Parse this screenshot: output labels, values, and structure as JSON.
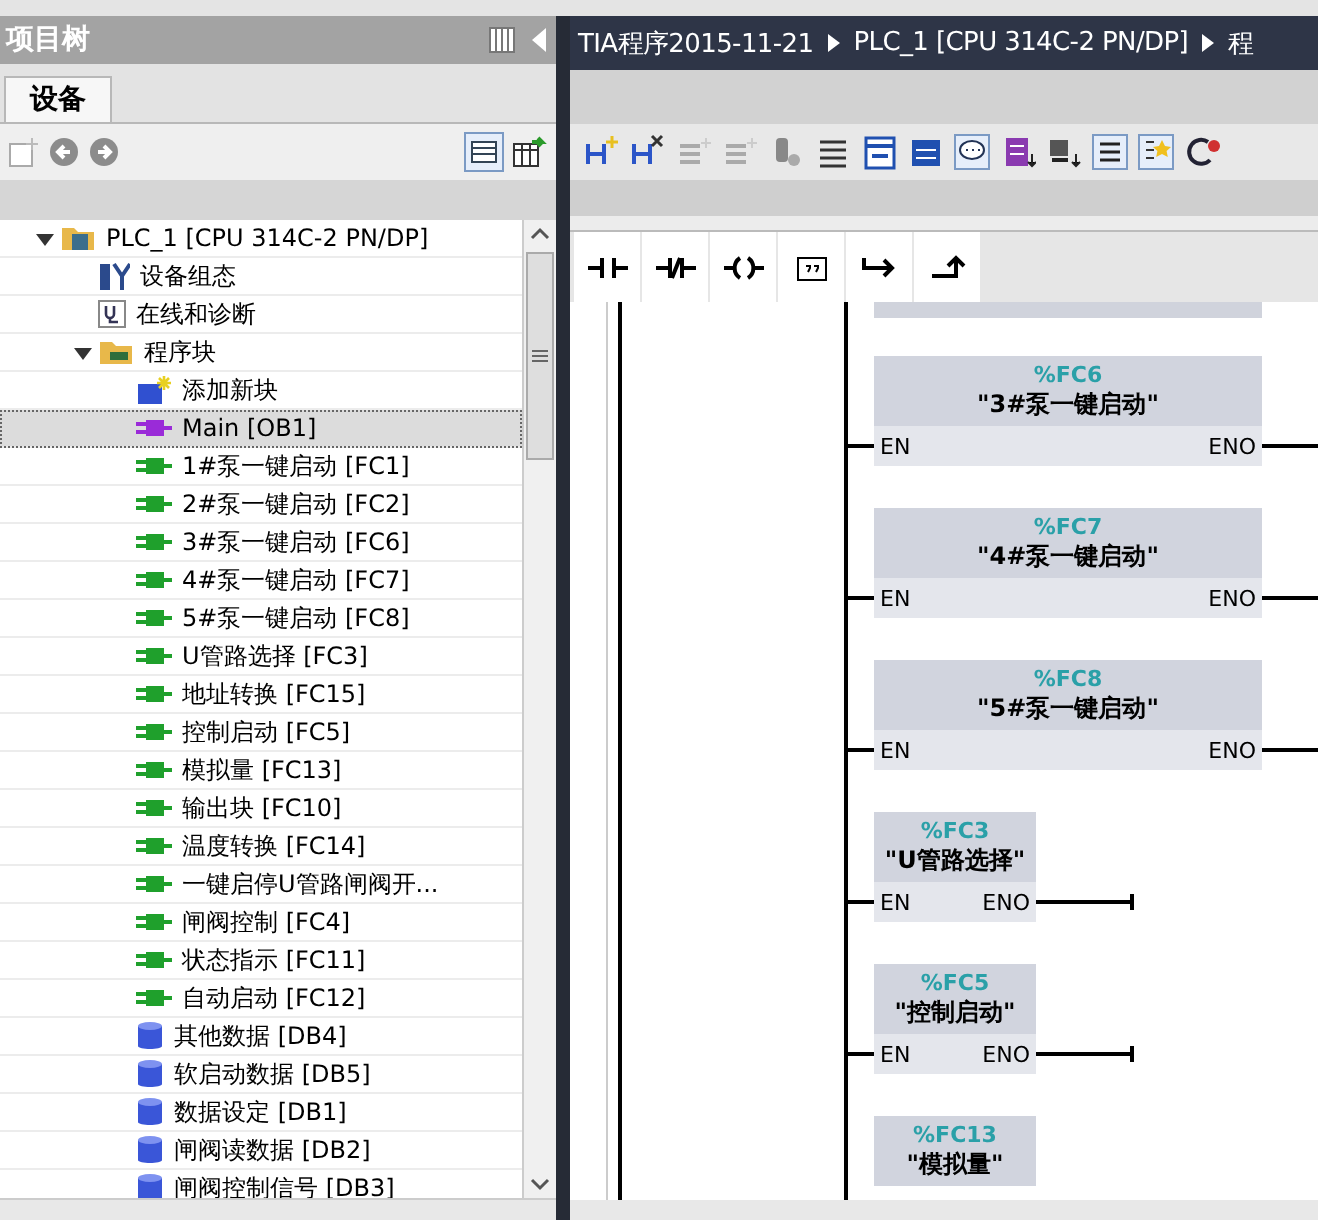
{
  "project_tree": {
    "title": "项目树",
    "tabs": [
      {
        "label": "设备",
        "selected": true
      }
    ],
    "items": [
      {
        "label": "PLC_1 [CPU 314C-2 PN/DP]",
        "kind": "plc",
        "expanded": true,
        "selected": false,
        "children": [
          {
            "label": "设备组态",
            "kind": "config",
            "selected": false
          },
          {
            "label": "在线和诊断",
            "kind": "online",
            "selected": false
          },
          {
            "label": "程序块",
            "kind": "folder",
            "expanded": true,
            "selected": false,
            "children": [
              {
                "label": "添加新块",
                "kind": "add",
                "selected": false
              },
              {
                "label": "Main [OB1]",
                "kind": "ob",
                "selected": true
              },
              {
                "label": "1#泵一键启动 [FC1]",
                "kind": "fc",
                "selected": false
              },
              {
                "label": "2#泵一键启动 [FC2]",
                "kind": "fc",
                "selected": false
              },
              {
                "label": "3#泵一键启动 [FC6]",
                "kind": "fc",
                "selected": false
              },
              {
                "label": "4#泵一键启动 [FC7]",
                "kind": "fc",
                "selected": false
              },
              {
                "label": "5#泵一键启动 [FC8]",
                "kind": "fc",
                "selected": false
              },
              {
                "label": "U管路选择 [FC3]",
                "kind": "fc",
                "selected": false
              },
              {
                "label": "地址转换 [FC15]",
                "kind": "fc",
                "selected": false
              },
              {
                "label": "控制启动 [FC5]",
                "kind": "fc",
                "selected": false
              },
              {
                "label": "模拟量 [FC13]",
                "kind": "fc",
                "selected": false
              },
              {
                "label": "输出块 [FC10]",
                "kind": "fc",
                "selected": false
              },
              {
                "label": "温度转换 [FC14]",
                "kind": "fc",
                "selected": false
              },
              {
                "label": "一键启停U管路闸阀开...",
                "kind": "fc",
                "selected": false
              },
              {
                "label": "闸阀控制 [FC4]",
                "kind": "fc",
                "selected": false
              },
              {
                "label": "状态指示 [FC11]",
                "kind": "fc",
                "selected": false
              },
              {
                "label": "自动启动 [FC12]",
                "kind": "fc",
                "selected": false
              },
              {
                "label": "其他数据 [DB4]",
                "kind": "db",
                "selected": false
              },
              {
                "label": "软启动数据 [DB5]",
                "kind": "db",
                "selected": false
              },
              {
                "label": "数据设定 [DB1]",
                "kind": "db",
                "selected": false
              },
              {
                "label": "闸阀读数据 [DB2]",
                "kind": "db",
                "selected": false
              },
              {
                "label": "闸阀控制信号 [DB3]",
                "kind": "db",
                "selected": false
              }
            ]
          }
        ]
      }
    ]
  },
  "breadcrumb": [
    "TIA程序2015-11-21",
    "PLC_1 [CPU 314C-2 PN/DP]",
    "程"
  ],
  "blocks": [
    {
      "address": "%FC6",
      "name": "\"3#泵一键启动\"",
      "kind": "wide",
      "en": "EN",
      "eno": "ENO"
    },
    {
      "address": "%FC7",
      "name": "\"4#泵一键启动\"",
      "kind": "wide",
      "en": "EN",
      "eno": "ENO"
    },
    {
      "address": "%FC8",
      "name": "\"5#泵一键启动\"",
      "kind": "wide",
      "en": "EN",
      "eno": "ENO"
    },
    {
      "address": "%FC3",
      "name": "\"U管路选择\"",
      "kind": "narrow",
      "en": "EN",
      "eno": "ENO"
    },
    {
      "address": "%FC5",
      "name": "\"控制启动\"",
      "kind": "narrow",
      "en": "EN",
      "eno": "ENO"
    },
    {
      "address": "%FC13",
      "name": "\"模拟量\"",
      "kind": "narrow"
    }
  ]
}
